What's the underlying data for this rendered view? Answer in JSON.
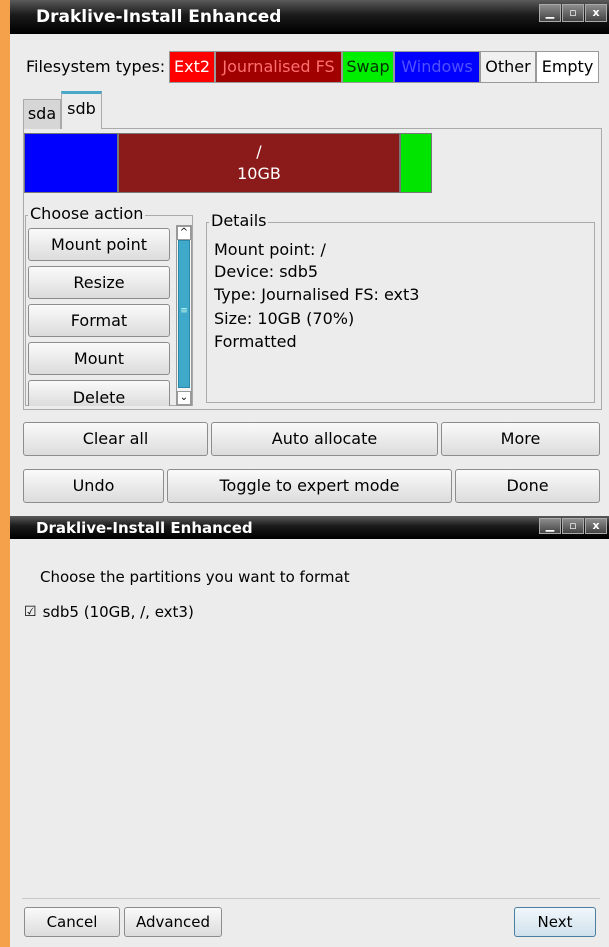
{
  "window1": {
    "title": "Draklive-Install Enhanced",
    "controls": {
      "minimize": "▁",
      "maximize": "▫",
      "close": "x"
    }
  },
  "filesystem_types": {
    "label": "Filesystem types:",
    "chips": [
      {
        "label": "Ext2",
        "bg": "#ff0000",
        "fg": "#ffffff"
      },
      {
        "label": "Journalised FS",
        "bg": "#a00000",
        "fg": "#ff7070"
      },
      {
        "label": "Swap",
        "bg": "#00ee00",
        "fg": "#003300"
      },
      {
        "label": "Windows",
        "bg": "#0000ff",
        "fg": "#5050ff"
      },
      {
        "label": "Other",
        "bg": "#f0f0f0",
        "fg": "#000000"
      },
      {
        "label": "Empty",
        "bg": "#ffffff",
        "fg": "#000000"
      }
    ]
  },
  "tabs": [
    {
      "label": "sda",
      "active": false
    },
    {
      "label": "sdb",
      "active": true
    }
  ],
  "partition_bar": {
    "segments": [
      {
        "kind": "windows",
        "color": "#0000ff",
        "mount": "",
        "size": ""
      },
      {
        "kind": "journalised",
        "color": "#8b1a1a",
        "mount": "/",
        "size": "10GB"
      },
      {
        "kind": "swap",
        "color": "#00e400",
        "mount": "",
        "size": ""
      }
    ]
  },
  "choose_action": {
    "legend": "Choose action",
    "buttons": [
      "Mount point",
      "Resize",
      "Format",
      "Mount",
      "Delete"
    ]
  },
  "details": {
    "legend": "Details",
    "lines": [
      "Mount point: /",
      "Device: sdb5",
      "Type: Journalised FS: ext3",
      "Size: 10GB (70%)",
      "Formatted"
    ]
  },
  "bottom_row1": [
    "Clear all",
    "Auto allocate",
    "More"
  ],
  "bottom_row2": [
    "Undo",
    "Toggle to expert mode",
    "Done"
  ],
  "window2": {
    "title": "Draklive-Install Enhanced",
    "heading": "Choose the partitions you want to format",
    "checkbox_mark": "☑",
    "checkbox_label": "sdb5 (10GB, /, ext3)",
    "checked": true,
    "cancel": "Cancel",
    "advanced": "Advanced",
    "next": "Next"
  },
  "colors": {
    "desktop": "#f5a04a",
    "window_bg": "#ececec",
    "accent": "#3fa9cc"
  }
}
